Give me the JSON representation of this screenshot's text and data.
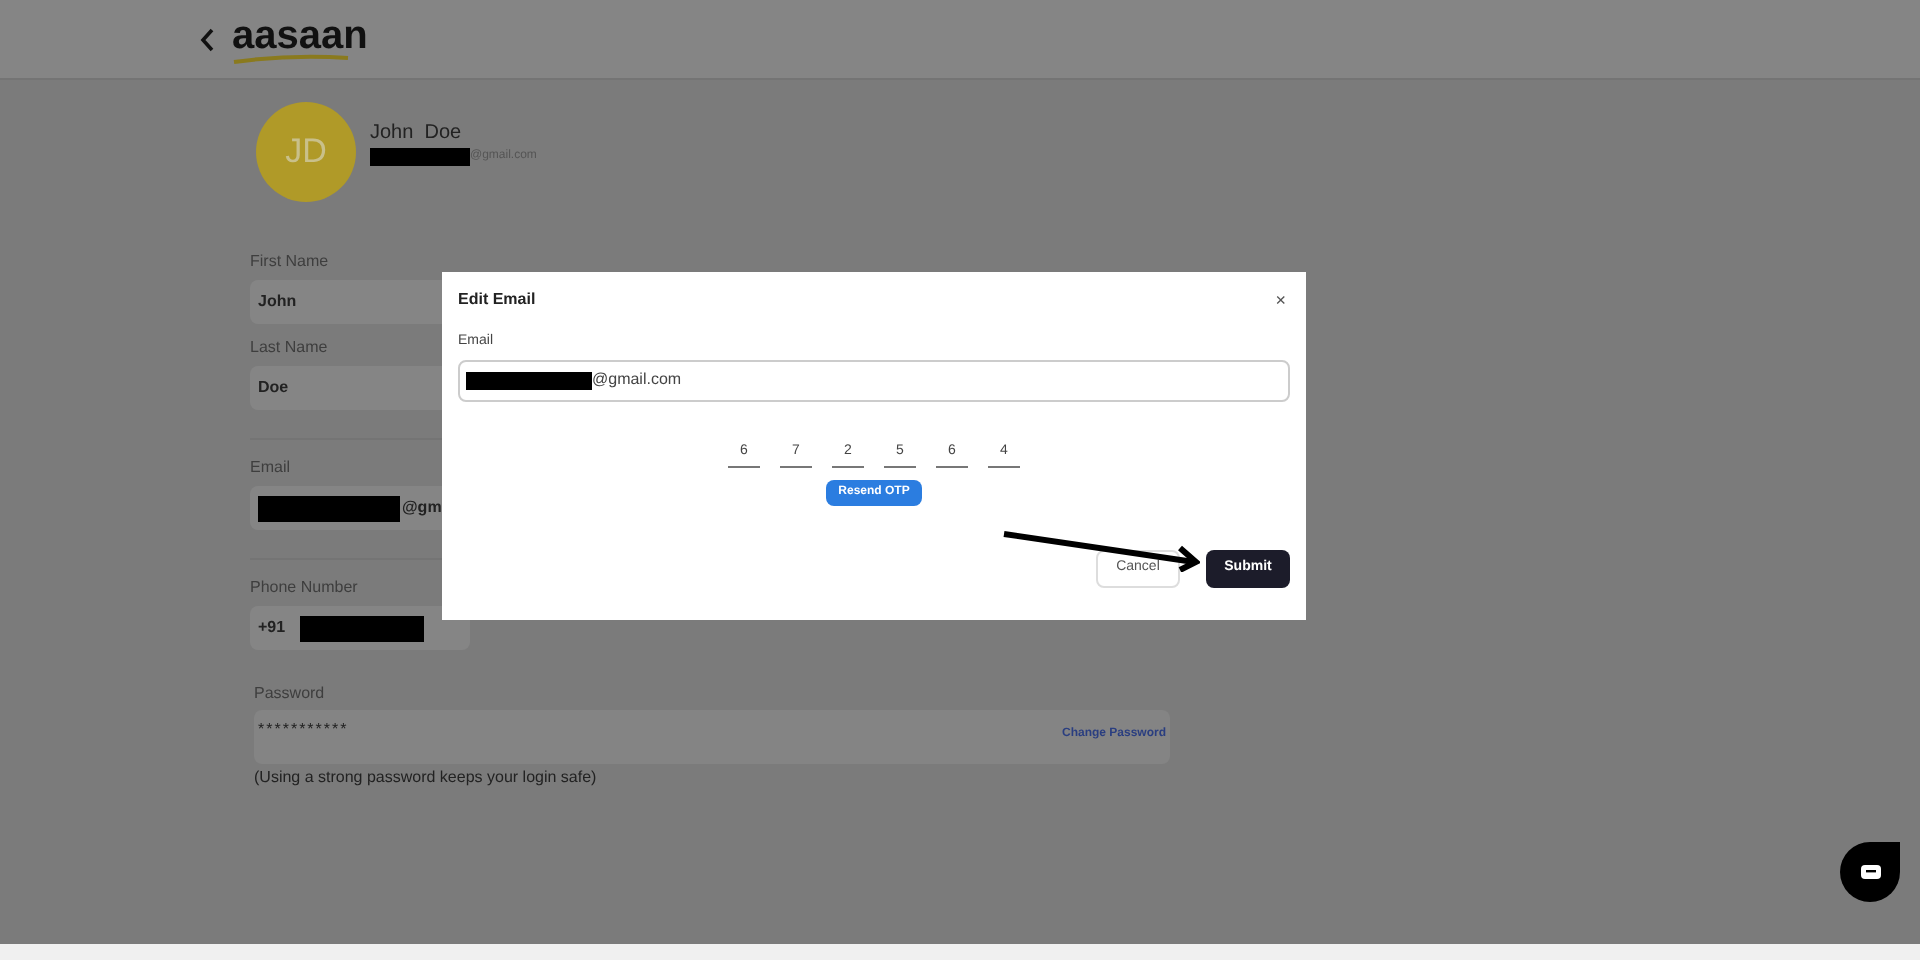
{
  "header": {
    "logo": "aasaan"
  },
  "profile": {
    "initials": "JD",
    "name": "John  Doe",
    "email": "@gmail.com"
  },
  "fields": [
    {
      "kind": "plain",
      "label": "First Name",
      "value": "John"
    },
    {
      "kind": "plain",
      "label": "Last Name",
      "value": "Doe"
    },
    {
      "kind": "masked_prefix",
      "label": "Email",
      "value": "@gm"
    },
    {
      "kind": "masked_suffix",
      "label": "Phone Number",
      "value": "+91"
    }
  ],
  "password": {
    "label": "Password",
    "value": "***********",
    "link": "Change Password",
    "hint": "(Using a strong password keeps your login safe)"
  },
  "modal": {
    "title": "Edit Email",
    "close": "×",
    "email_label": "Email",
    "email_value": "@gmail.com",
    "otp": [
      "6",
      "7",
      "2",
      "5",
      "6",
      "4"
    ],
    "resend": "Resend OTP",
    "cancel": "Cancel",
    "submit": "Submit"
  }
}
